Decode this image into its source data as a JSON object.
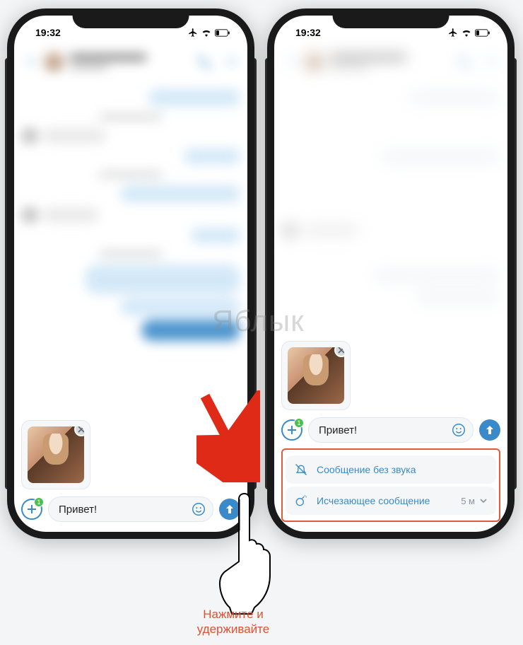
{
  "status": {
    "time": "19:32",
    "airplane": true,
    "wifi": true,
    "battery": "low"
  },
  "composer": {
    "attach_badge": "1",
    "input_value": "Привет!",
    "send_label": "send"
  },
  "options": {
    "silent_label": "Сообщение без звука",
    "disappearing_label": "Исчезающее сообщение",
    "duration": "5 м"
  },
  "annotation": {
    "caption_line1": "Нажмите и",
    "caption_line2": "удерживайте"
  },
  "watermark": "Яблык"
}
